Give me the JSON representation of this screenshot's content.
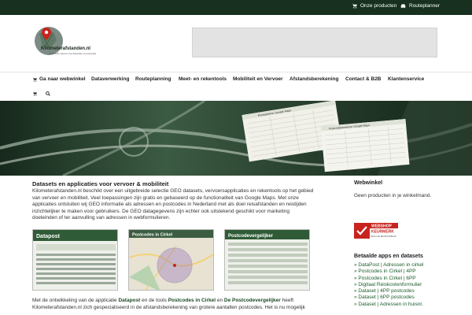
{
  "topbar": {
    "products_label": "Onze producten",
    "routeplanner_label": "Routeplanner"
  },
  "logo": {
    "name": "Kilometerafstanden.nl",
    "tagline": "gratis tools rekenen met afstanden en postcodes"
  },
  "nav": {
    "items": [
      {
        "label": "Ga naar webwinkel"
      },
      {
        "label": "Dataverwerking"
      },
      {
        "label": "Routeplanning"
      },
      {
        "label": "Meet- en rekentools"
      },
      {
        "label": "Mobiliteit en Vervoer"
      },
      {
        "label": "Afstandsberekening"
      },
      {
        "label": "Contact & B2B"
      },
      {
        "label": "Klantenservice"
      }
    ]
  },
  "banner": {
    "sheet1_title": "Routeplanner Google Maps",
    "sheet2_title": "Postcodeberekener Google Maps"
  },
  "main": {
    "title": "Datasets en applicaties voor vervoer & mobiliteit",
    "intro": "Kilometerafstanden.nl beschikt over een uitgebreide selectie GEO datasets, vervoersapplicaties en rekentools op het gebied van vervoer en mobiliteit. Veel toepassingen zijn gratis en gebaseerd op de functionaliteit van Google Maps. Met onze applicaties ontsluiten wij GEO informatie als adressen en postcodes in Nederland met als doel reisafstanden en reistijden inzichtelijker te maken voor gebruikers. De GEO datagegevens zijn echter ook uitstekend geschikt voor marketing doeleinden of ter aanvulling van adressen in webformulieren.",
    "shots": [
      {
        "title": "Datapost"
      },
      {
        "title": "Postcodes in Cirkel"
      },
      {
        "title": "Postcodevergelijker"
      }
    ],
    "outro_prefix": "Met de ontwikkeling van de applicatie ",
    "outro_link1": "Datapost",
    "outro_mid1": " en de tools ",
    "outro_link2": "Postcodes in Cirkel",
    "outro_mid2": " en ",
    "outro_link3": "De Postcodevergelijker",
    "outro_suffix": " heeft",
    "outro_line2": "Kilometerafstanden.nl zich gespecialiseerd in de afstandsberekening van grotere aantallen postcodes. Het is nu mogelijk"
  },
  "sidebar": {
    "webwinkel_title": "Webwinkel",
    "webwinkel_text": "Geen producten in je winkelmand.",
    "badge_line1": "WEBSHOP",
    "badge_line2": "KEURMERK",
    "badge_line3": "VEILIG EN BETROUWBAAR",
    "apps_title": "Betaalde apps en datasets",
    "apps": [
      "» DataPost | Adressen in cirkel",
      "» Postcodes in Cirkel | 4PP",
      "» Postcodes in Cirkel | 6PP",
      "» Digitaal Reiskostenformulier",
      "» Dataset | 4PP postcodes",
      "» Dataset | 6PP postcodes",
      "» Dataset | Adressen in huisnr."
    ]
  }
}
